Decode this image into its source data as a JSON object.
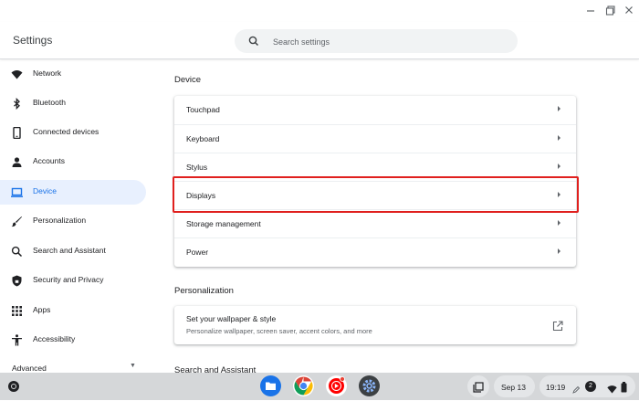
{
  "window": {
    "minimize_icon": "minimize-icon",
    "maximize_icon": "maximize-icon",
    "close_icon": "close-icon"
  },
  "header": {
    "title": "Settings",
    "search_placeholder": "Search settings"
  },
  "sidebar": {
    "items": [
      {
        "label": "Network",
        "icon": "wifi-icon"
      },
      {
        "label": "Bluetooth",
        "icon": "bluetooth-icon"
      },
      {
        "label": "Connected devices",
        "icon": "phone-icon"
      },
      {
        "label": "Accounts",
        "icon": "person-icon"
      },
      {
        "label": "Device",
        "icon": "laptop-icon",
        "active": true
      },
      {
        "label": "Personalization",
        "icon": "brush-icon"
      },
      {
        "label": "Search and Assistant",
        "icon": "search-icon"
      },
      {
        "label": "Security and Privacy",
        "icon": "shield-icon"
      },
      {
        "label": "Apps",
        "icon": "apps-grid-icon"
      },
      {
        "label": "Accessibility",
        "icon": "accessibility-icon"
      }
    ],
    "advanced_label": "Advanced"
  },
  "main": {
    "device": {
      "title": "Device",
      "rows": [
        {
          "label": "Touchpad"
        },
        {
          "label": "Keyboard"
        },
        {
          "label": "Stylus"
        },
        {
          "label": "Displays",
          "highlighted": true
        },
        {
          "label": "Storage management"
        },
        {
          "label": "Power"
        }
      ]
    },
    "personalization": {
      "title": "Personalization",
      "wallpaper_title": "Set your wallpaper & style",
      "wallpaper_subtitle": "Personalize wallpaper, screen saver, accent colors, and more"
    },
    "search_assistant_title": "Search and Assistant"
  },
  "shelf": {
    "apps": [
      "files-icon",
      "chrome-icon",
      "youtube-music-icon",
      "settings-icon"
    ],
    "date": "Sep 13",
    "time": "19:19",
    "notification_count": "2"
  },
  "colors": {
    "accent": "#1a73e8",
    "active_bg": "#e8f0fe",
    "highlight_border": "#e0201e",
    "shelf_bg": "#d5d7d9"
  }
}
